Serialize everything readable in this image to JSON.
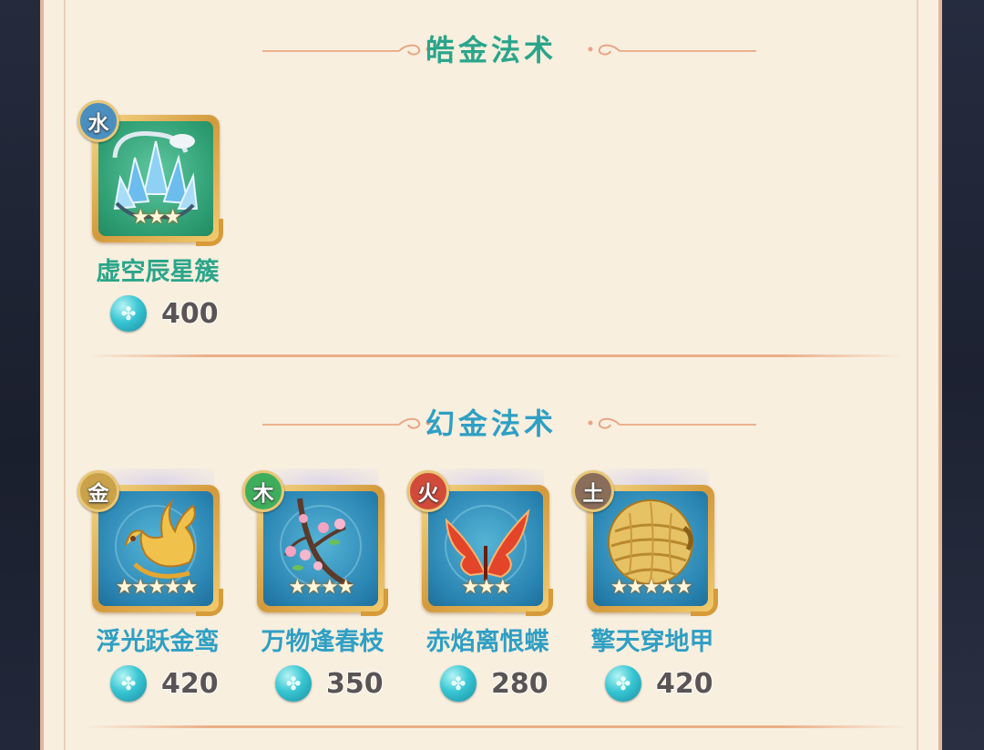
{
  "sections": [
    {
      "title": "皓金法术",
      "items": [
        {
          "name": "虚空辰星簇",
          "element": "水",
          "stars": "★★★",
          "price": "400",
          "icon": "ice-crystal-icon"
        }
      ]
    },
    {
      "title": "幻金法术",
      "items": [
        {
          "name": "浮光跃金鸾",
          "element": "金",
          "stars": "★★★★★",
          "price": "420",
          "icon": "golden-phoenix-icon"
        },
        {
          "name": "万物逢春枝",
          "element": "木",
          "stars": "★★★★",
          "price": "350",
          "icon": "blossom-branch-icon"
        },
        {
          "name": "赤焰离恨蝶",
          "element": "火",
          "stars": "★★★",
          "price": "280",
          "icon": "fire-butterfly-icon"
        },
        {
          "name": "擎天穿地甲",
          "element": "土",
          "stars": "★★★★★",
          "price": "420",
          "icon": "pangolin-armor-icon"
        }
      ]
    }
  ],
  "colors": {
    "panel_bg": "#f8efdf",
    "title_teal": "#2aa58a",
    "title_blue": "#2f9fc4",
    "badge_water": "#4a8fbf",
    "badge_metal": "#c9a24a",
    "badge_wood": "#3fae5c",
    "badge_fire": "#d24a3a",
    "badge_earth": "#8a6e5a"
  },
  "currency_icon": "cyan-orb-icon"
}
